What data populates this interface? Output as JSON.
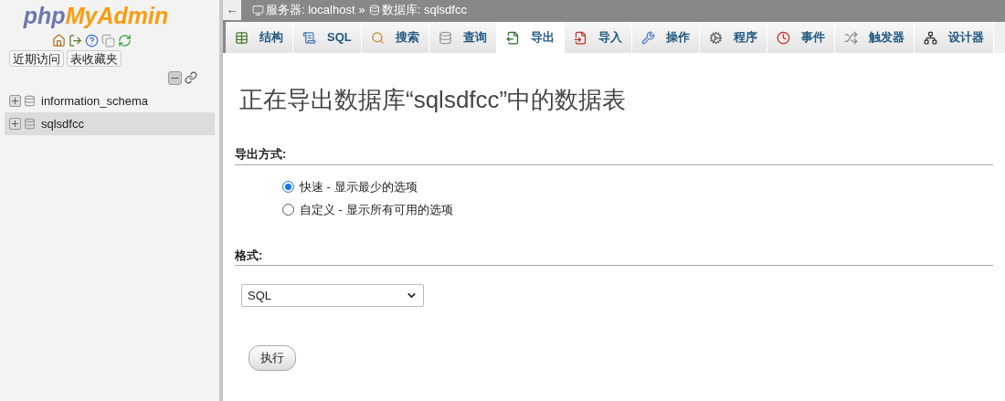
{
  "logo": {
    "part_1": "php",
    "part_2": "MyAdmin"
  },
  "sidebar": {
    "buttons": [
      "近期访问",
      "表收藏夹"
    ],
    "tree": [
      {
        "label": "information_schema",
        "selected": false
      },
      {
        "label": "sqlsdfcc",
        "selected": true
      }
    ]
  },
  "breadcrumb": {
    "back": "←",
    "server": "服务器: localhost",
    "separator": "»",
    "database": "数据库: sqlsdfcc"
  },
  "tabs": [
    {
      "label": "结构",
      "selected": false
    },
    {
      "label": "SQL",
      "selected": false
    },
    {
      "label": "搜索",
      "selected": false
    },
    {
      "label": "查询",
      "selected": false
    },
    {
      "label": "导出",
      "selected": true
    },
    {
      "label": "导入",
      "selected": false
    },
    {
      "label": "操作",
      "selected": false
    },
    {
      "label": "程序",
      "selected": false
    },
    {
      "label": "事件",
      "selected": false
    },
    {
      "label": "触发器",
      "selected": false
    },
    {
      "label": "设计器",
      "selected": false
    }
  ],
  "heading": "正在导出数据库“sqlsdfcc”中的数据表",
  "export_method": {
    "title": "导出方式:",
    "options": [
      {
        "label": "快速 - 显示最少的选项",
        "selected": true
      },
      {
        "label": "自定义 - 显示所有可用的选项",
        "selected": false
      }
    ]
  },
  "format": {
    "title": "格式:",
    "value": "SQL"
  },
  "submit": "执行"
}
